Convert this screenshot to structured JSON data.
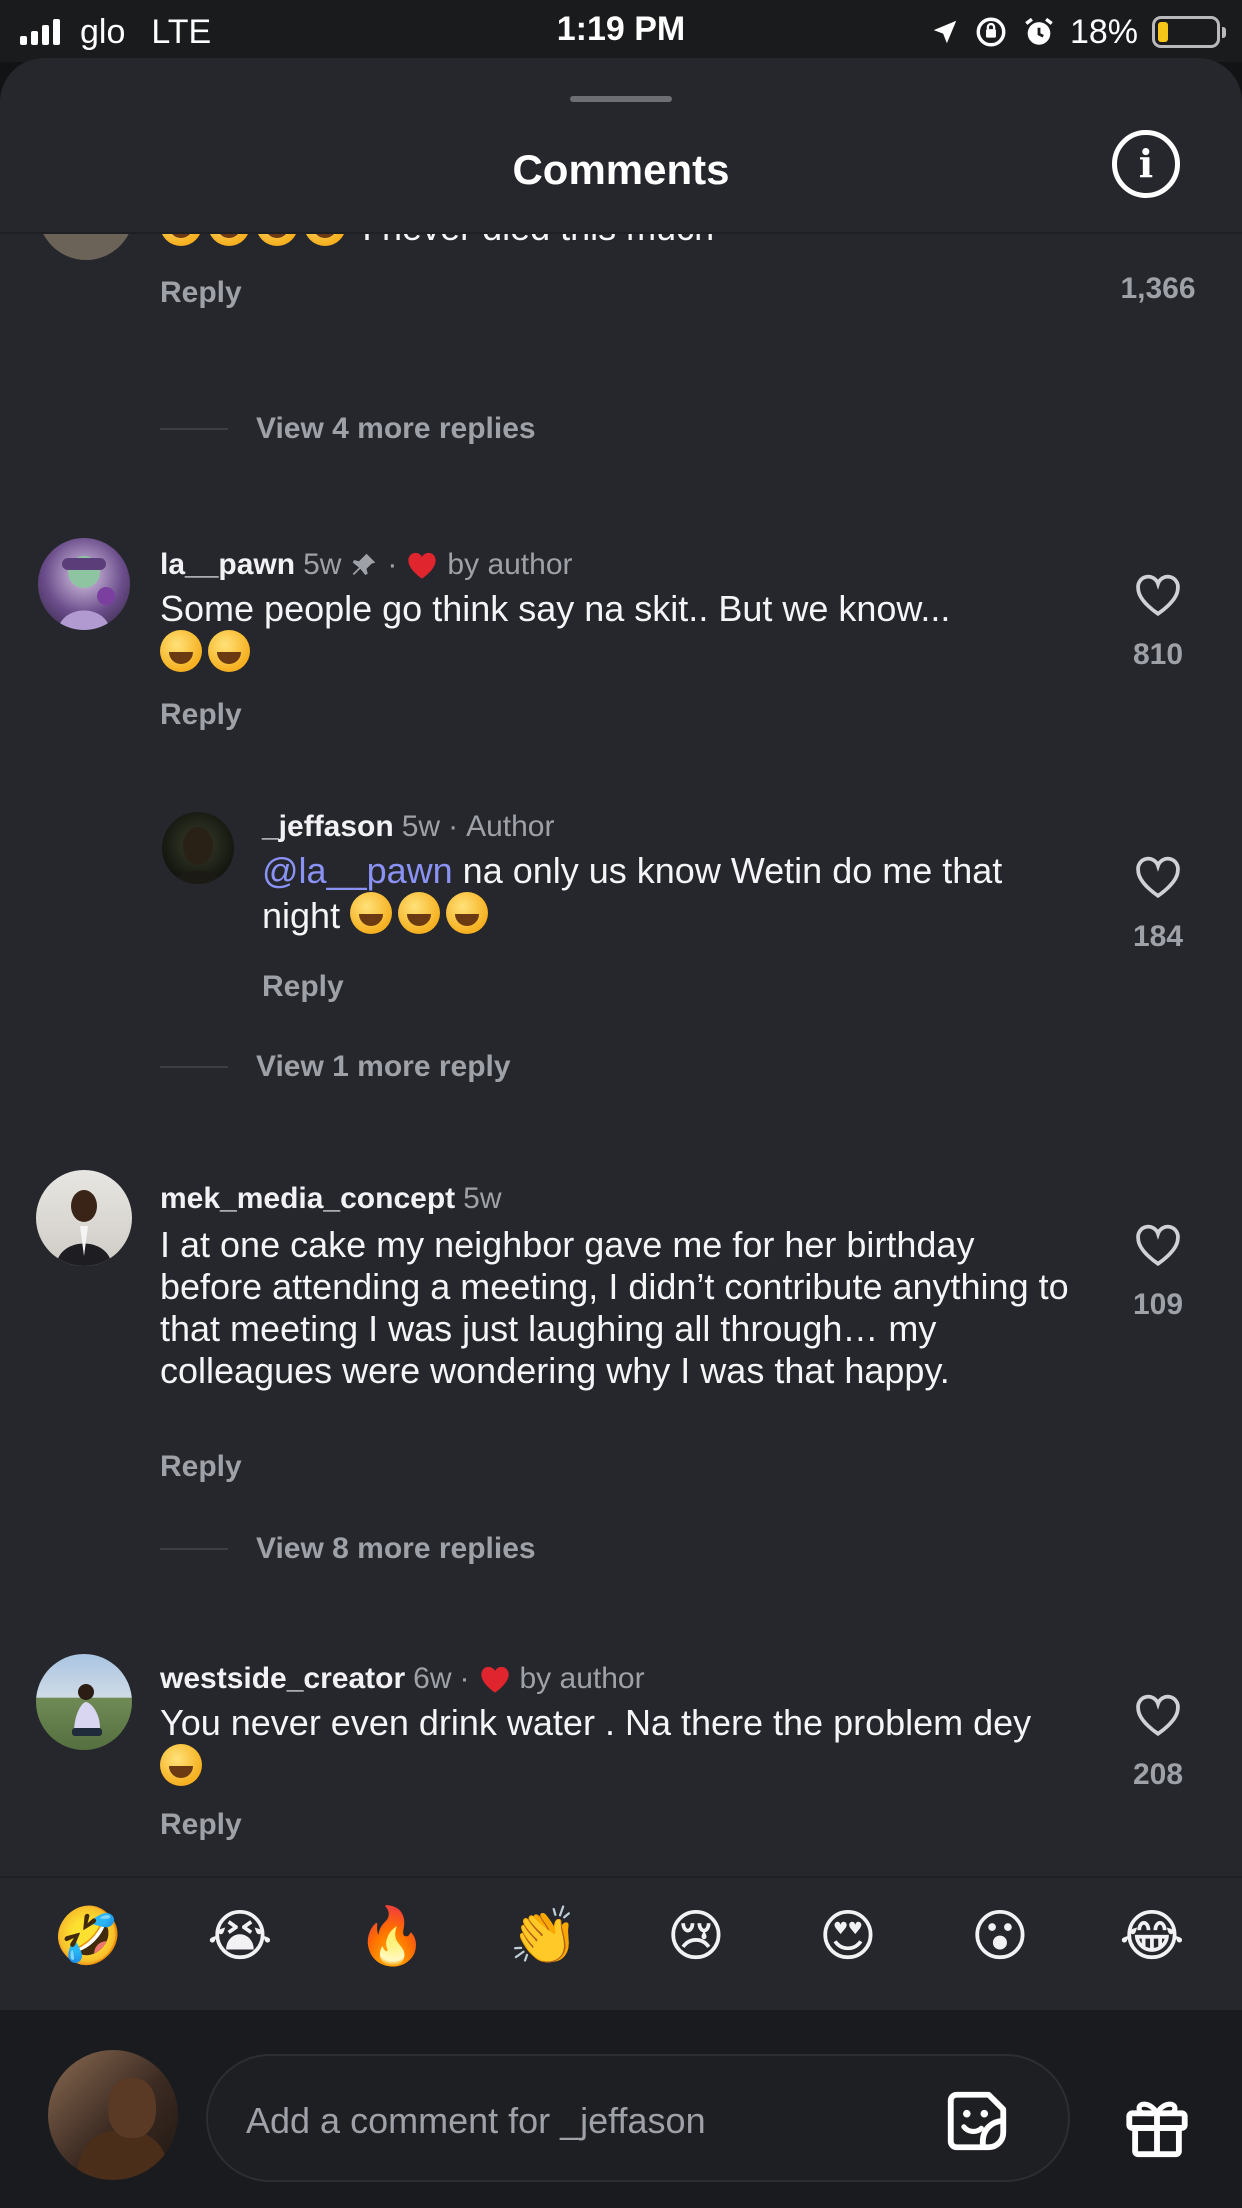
{
  "status_bar": {
    "carrier": "glo",
    "network": "LTE",
    "time": "1:19 PM",
    "battery": "18%"
  },
  "sheet": {
    "title": "Comments",
    "info_icon": "info-circle-icon"
  },
  "partial_comment": {
    "text": "I never died this much",
    "reply_label": "Reply",
    "like_count": "1,366",
    "view_more": "View 4 more replies"
  },
  "comments": [
    {
      "username": "la__pawn",
      "age": "5w",
      "pinned": true,
      "dot": "·",
      "liked_by": "by author",
      "text": "Some people go think say na skit.. But we know...",
      "reply_label": "Reply",
      "like_count": "810",
      "reply": {
        "username": "_jeffason",
        "age": "5w",
        "dot": "·",
        "role": "Author",
        "mention": "@la__pawn",
        "text": " na only us know Wetin do me that night",
        "reply_label": "Reply",
        "like_count": "184"
      },
      "view_more": "View 1 more reply"
    },
    {
      "username": "mek_media_concept",
      "age": "5w",
      "text": "I at one cake my neighbor gave me for her birthday before attending a meeting, I didn’t contribute anything to that meeting I was just laughing all through… my colleagues were wondering why I was that happy.",
      "reply_label": "Reply",
      "like_count": "109",
      "view_more": "View 8 more replies"
    },
    {
      "username": "westside_creator",
      "age": "6w",
      "dot": "·",
      "liked_by": "by author",
      "text": "You never even drink water . Na there the problem dey",
      "reply_label": "Reply",
      "like_count": "208"
    }
  ],
  "emoji_bar": [
    "🤣",
    "😭",
    "🔥",
    "👏",
    "😢",
    "😍",
    "😮",
    "😂"
  ],
  "composer": {
    "placeholder": "Add a comment for _jeffason",
    "sticker_icon": "sticker-icon",
    "gift_icon": "gift-icon"
  },
  "colors": {
    "sheet_bg": "#25272c",
    "mention": "#8b92f5",
    "heart_red": "#e0252f",
    "muted_text": "#9ea1a8"
  }
}
